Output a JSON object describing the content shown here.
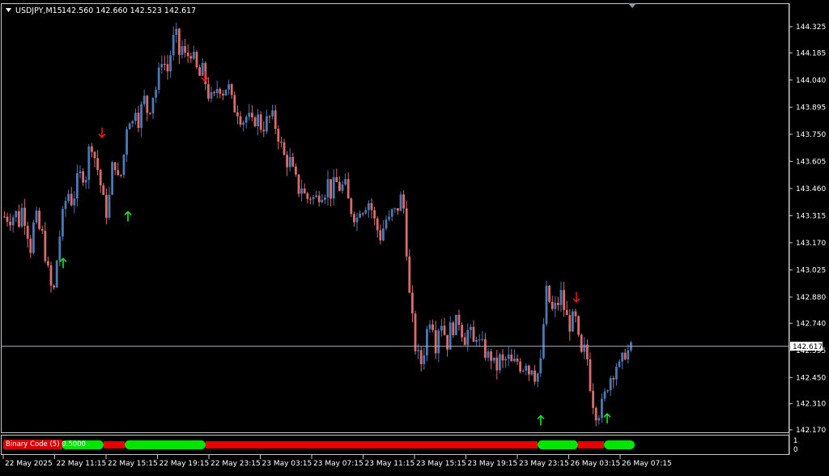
{
  "header": {
    "symbol": "USDJPY,M15",
    "ohlc": "142.560 142.660 142.523 142.617"
  },
  "colors": {
    "background": "#000000",
    "bull": "#4a79b4",
    "bear": "#d86b6b",
    "grid_frame": "#c8c8c8",
    "text": "#ffffff",
    "arrow_up": "#19e619",
    "arrow_down": "#e61919",
    "indicator_green": "#00e600",
    "indicator_red": "#e60000",
    "current_price_line": "#a8b4c0"
  },
  "chart_data": [
    {
      "type": "candlestick",
      "symbol": "USDJPY",
      "timeframe": "M15",
      "y_axis_ticks": [
        "144.325",
        "144.185",
        "144.040",
        "143.895",
        "143.750",
        "143.605",
        "143.460",
        "143.315",
        "143.170",
        "143.025",
        "142.880",
        "142.740",
        "142.595",
        "142.450",
        "142.310",
        "142.170"
      ],
      "x_axis_ticks": [
        "22 May 2025",
        "22 May 11:15",
        "22 May 15:15",
        "22 May 19:15",
        "22 May 23:15",
        "23 May 03:15",
        "23 May 07:15",
        "23 May 11:15",
        "23 May 15:15",
        "23 May 19:15",
        "23 May 23:15",
        "26 May 03:15",
        "26 May 07:15"
      ],
      "ylim": [
        142.17,
        144.325
      ],
      "current_price": "142.617",
      "close_path": [
        [
          0,
          143.31
        ],
        [
          8,
          143.3
        ],
        [
          14,
          143.33
        ],
        [
          18,
          143.28
        ],
        [
          22,
          143.36
        ],
        [
          28,
          143.25
        ],
        [
          32,
          143.13
        ],
        [
          38,
          143.33
        ],
        [
          42,
          143.25
        ],
        [
          48,
          143.2
        ],
        [
          52,
          143.05
        ],
        [
          56,
          142.98
        ],
        [
          60,
          142.86
        ],
        [
          64,
          143.05
        ],
        [
          68,
          143.2
        ],
        [
          72,
          143.31
        ],
        [
          78,
          143.45
        ],
        [
          84,
          143.38
        ],
        [
          90,
          143.5
        ],
        [
          96,
          143.55
        ],
        [
          100,
          143.5
        ],
        [
          104,
          143.66
        ],
        [
          108,
          143.7
        ],
        [
          112,
          143.62
        ],
        [
          116,
          143.55
        ],
        [
          120,
          143.45
        ],
        [
          124,
          143.35
        ],
        [
          128,
          143.32
        ],
        [
          132,
          143.55
        ],
        [
          136,
          143.62
        ],
        [
          140,
          143.5
        ],
        [
          146,
          143.55
        ],
        [
          150,
          143.78
        ],
        [
          154,
          143.85
        ],
        [
          158,
          143.8
        ],
        [
          162,
          143.9
        ],
        [
          166,
          143.82
        ],
        [
          172,
          143.95
        ],
        [
          178,
          143.85
        ],
        [
          182,
          143.95
        ],
        [
          188,
          144.0
        ],
        [
          192,
          144.1
        ],
        [
          196,
          144.2
        ],
        [
          200,
          144.05
        ],
        [
          204,
          144.15
        ],
        [
          208,
          144.25
        ],
        [
          212,
          144.28
        ],
        [
          216,
          144.18
        ],
        [
          220,
          144.22
        ],
        [
          224,
          144.15
        ],
        [
          230,
          144.2
        ],
        [
          236,
          144.12
        ],
        [
          240,
          144.05
        ],
        [
          246,
          144.1
        ],
        [
          250,
          143.98
        ],
        [
          254,
          143.95
        ],
        [
          258,
          143.92
        ],
        [
          264,
          144.02
        ],
        [
          270,
          143.98
        ],
        [
          276,
          144.02
        ],
        [
          282,
          143.9
        ],
        [
          288,
          143.88
        ],
        [
          294,
          143.82
        ],
        [
          300,
          143.85
        ],
        [
          306,
          143.8
        ],
        [
          312,
          143.85
        ],
        [
          318,
          143.78
        ],
        [
          324,
          143.82
        ],
        [
          330,
          143.85
        ],
        [
          336,
          143.78
        ],
        [
          340,
          143.72
        ],
        [
          344,
          143.65
        ],
        [
          348,
          143.6
        ],
        [
          352,
          143.62
        ],
        [
          356,
          143.55
        ],
        [
          360,
          143.5
        ],
        [
          364,
          143.45
        ],
        [
          368,
          143.48
        ],
        [
          372,
          143.4
        ],
        [
          378,
          143.42
        ],
        [
          384,
          143.4
        ],
        [
          390,
          143.44
        ],
        [
          396,
          143.45
        ],
        [
          400,
          143.5
        ],
        [
          404,
          143.42
        ],
        [
          408,
          143.5
        ],
        [
          412,
          143.48
        ],
        [
          416,
          143.45
        ],
        [
          420,
          143.5
        ],
        [
          424,
          143.4
        ],
        [
          428,
          143.35
        ],
        [
          432,
          143.32
        ],
        [
          436,
          143.3
        ],
        [
          440,
          143.38
        ],
        [
          444,
          143.35
        ],
        [
          448,
          143.4
        ],
        [
          452,
          143.38
        ],
        [
          456,
          143.3
        ],
        [
          460,
          143.25
        ],
        [
          464,
          143.2
        ],
        [
          468,
          143.25
        ],
        [
          472,
          143.3
        ],
        [
          476,
          143.28
        ],
        [
          480,
          143.35
        ],
        [
          484,
          143.32
        ],
        [
          488,
          143.4
        ],
        [
          492,
          143.42
        ],
        [
          496,
          143.2
        ],
        [
          500,
          142.9
        ],
        [
          504,
          142.75
        ],
        [
          508,
          142.6
        ],
        [
          512,
          142.55
        ],
        [
          516,
          142.52
        ],
        [
          520,
          142.65
        ],
        [
          524,
          142.75
        ],
        [
          528,
          142.8
        ],
        [
          532,
          142.6
        ],
        [
          536,
          142.72
        ],
        [
          540,
          142.75
        ],
        [
          544,
          142.68
        ],
        [
          548,
          142.62
        ],
        [
          552,
          142.75
        ],
        [
          556,
          142.7
        ],
        [
          560,
          142.78
        ],
        [
          564,
          142.72
        ],
        [
          568,
          142.65
        ],
        [
          572,
          142.7
        ],
        [
          576,
          142.68
        ],
        [
          580,
          142.62
        ],
        [
          584,
          142.7
        ],
        [
          588,
          142.6
        ],
        [
          592,
          142.62
        ],
        [
          596,
          142.55
        ],
        [
          600,
          142.58
        ],
        [
          604,
          142.52
        ],
        [
          608,
          142.5
        ],
        [
          612,
          142.55
        ],
        [
          616,
          142.52
        ],
        [
          620,
          142.55
        ],
        [
          624,
          142.55
        ],
        [
          628,
          142.5
        ],
        [
          632,
          142.55
        ],
        [
          636,
          142.52
        ],
        [
          640,
          142.5
        ],
        [
          644,
          142.55
        ],
        [
          648,
          142.48
        ],
        [
          652,
          142.52
        ],
        [
          656,
          142.45
        ],
        [
          660,
          142.48
        ],
        [
          664,
          142.55
        ],
        [
          668,
          142.92
        ],
        [
          672,
          142.88
        ],
        [
          676,
          142.8
        ],
        [
          680,
          142.82
        ],
        [
          684,
          142.85
        ],
        [
          688,
          142.9
        ],
        [
          692,
          142.8
        ],
        [
          696,
          142.75
        ],
        [
          700,
          142.72
        ],
        [
          704,
          142.8
        ],
        [
          708,
          142.68
        ],
        [
          712,
          142.55
        ],
        [
          716,
          142.6
        ],
        [
          720,
          142.55
        ],
        [
          724,
          142.4
        ],
        [
          728,
          142.3
        ],
        [
          732,
          142.25
        ],
        [
          736,
          142.28
        ],
        [
          740,
          142.32
        ],
        [
          744,
          142.4
        ],
        [
          748,
          142.45
        ],
        [
          752,
          142.48
        ],
        [
          756,
          142.52
        ],
        [
          760,
          142.5
        ],
        [
          764,
          142.55
        ],
        [
          768,
          142.6
        ],
        [
          772,
          142.58
        ],
        [
          776,
          142.62
        ]
      ],
      "signals": [
        {
          "type": "buy",
          "x": 74,
          "price": 143.06
        },
        {
          "type": "sell",
          "x": 122,
          "price": 143.76
        },
        {
          "type": "buy",
          "x": 154,
          "price": 143.31
        },
        {
          "type": "sell",
          "x": 249,
          "price": 144.06
        },
        {
          "type": "buy",
          "x": 664,
          "price": 142.22
        },
        {
          "type": "sell",
          "x": 708,
          "price": 142.88
        },
        {
          "type": "buy",
          "x": 746,
          "price": 142.23
        }
      ]
    },
    {
      "type": "indicator_strip",
      "label": "Binary Code (5) 0.5000",
      "scale_labels": [
        "1",
        "0"
      ],
      "segments": [
        {
          "from": 0,
          "to": 72,
          "state": "red"
        },
        {
          "from": 72,
          "to": 124,
          "state": "green"
        },
        {
          "from": 124,
          "to": 150,
          "state": "red"
        },
        {
          "from": 150,
          "to": 250,
          "state": "green"
        },
        {
          "from": 250,
          "to": 660,
          "state": "red"
        },
        {
          "from": 660,
          "to": 710,
          "state": "green"
        },
        {
          "from": 710,
          "to": 742,
          "state": "red"
        },
        {
          "from": 742,
          "to": 780,
          "state": "green"
        }
      ]
    }
  ]
}
